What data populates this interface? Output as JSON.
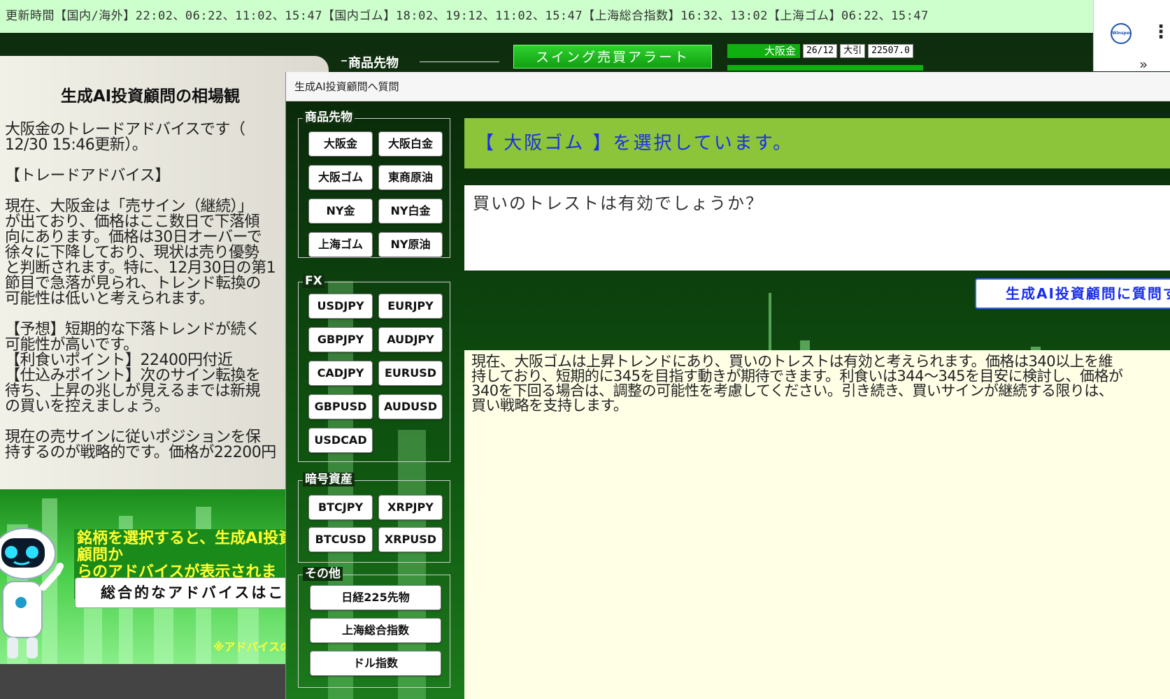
{
  "topbar": {
    "text": "更新時間【国内/海外】22:02、06:22、11:02、15:47【国内ゴム】18:02、19:12、11:02、15:47【上海総合指数】16:32、13:02【上海ゴム】06:22、15:47"
  },
  "browser": {
    "logo_text": "Winspec",
    "menu_glyph": "⋮",
    "overflow_glyph": "»"
  },
  "background": {
    "section_label": "商品先物",
    "swing_alert_label": "スイング売買アラート",
    "ticker": {
      "name": "大阪金",
      "contract": "26/12",
      "session": "大引",
      "price": "22507.0"
    }
  },
  "left_panel": {
    "title": "生成AI投資顧問の相場観",
    "body": "大阪金のトレードアドバイスです（\n12/30 15:46更新）。\n\n【トレードアドバイス】\n\n現在、大阪金は「売サイン（継続）」\nが出ており、価格はここ数日で下落傾\n向にあります。価格は30日オーバーで\n徐々に下降しており、現状は売り優勢\nと判断されます。特に、12月30日の第1\n節目で急落が見られ、トレンド転換の\n可能性は低いと考えられます。\n\n【予想】短期的な下落トレンドが続く\n可能性が高いです。\n【利食いポイント】22400円付近\n【仕込みポイント】次のサイン転換を\n待ち、上昇の兆しが見えるまでは新規\nの買いを控えましょう。\n\n現在の売サインに従いポジションを保\n持するのが戦略的です。価格が22200円",
    "hint": "銘柄を選択すると、生成AI投資顧問か\nらのアドバイスが表示されます。",
    "overall_button": "総合的なアドバイスはこちら",
    "note": "※アドバイスの"
  },
  "dialog": {
    "title": "生成AI投資顧問へ質問",
    "groups": {
      "commodities": {
        "label": "商品先物",
        "buttons": [
          "大阪金",
          "大阪白金",
          "大阪ゴム",
          "東商原油",
          "NY金",
          "NY白金",
          "上海ゴム",
          "NY原油"
        ]
      },
      "fx": {
        "label": "FX",
        "buttons": [
          "USDJPY",
          "EURJPY",
          "GBPJPY",
          "AUDJPY",
          "CADJPY",
          "EURUSD",
          "GBPUSD",
          "AUDUSD",
          "USDCAD"
        ]
      },
      "crypto": {
        "label": "暗号資産",
        "buttons": [
          "BTCJPY",
          "XRPJPY",
          "BTCUSD",
          "XRPUSD"
        ]
      },
      "other": {
        "label": "その他",
        "buttons": [
          "日経225先物",
          "上海総合指数",
          "ドル指数"
        ]
      }
    },
    "selection_text": "【 大阪ゴム 】を選択しています。",
    "question_text": "買いのトレストは有効でしょうか？",
    "ask_button": "生成AI投資顧問に質問する",
    "answer_text": "現在、大阪ゴムは上昇トレンドにあり、買いのトレストは有効と考えられます。価格は340以上を維\n持しており、短期的に345を目指す動きが期待できます。利食いは344～345を目安に検討し、価格が\n340を下回る場合は、調整の可能性を考慮してください。引き続き、買いサインが継続する限りは、\n買い戦略を支持します。"
  },
  "colors": {
    "topbar_bg": "#ccffcc",
    "selection_bg": "#8cc43a",
    "selection_text": "#1a2eea",
    "hint_text": "#ffff33",
    "answer_bg": "#ffffe6"
  }
}
